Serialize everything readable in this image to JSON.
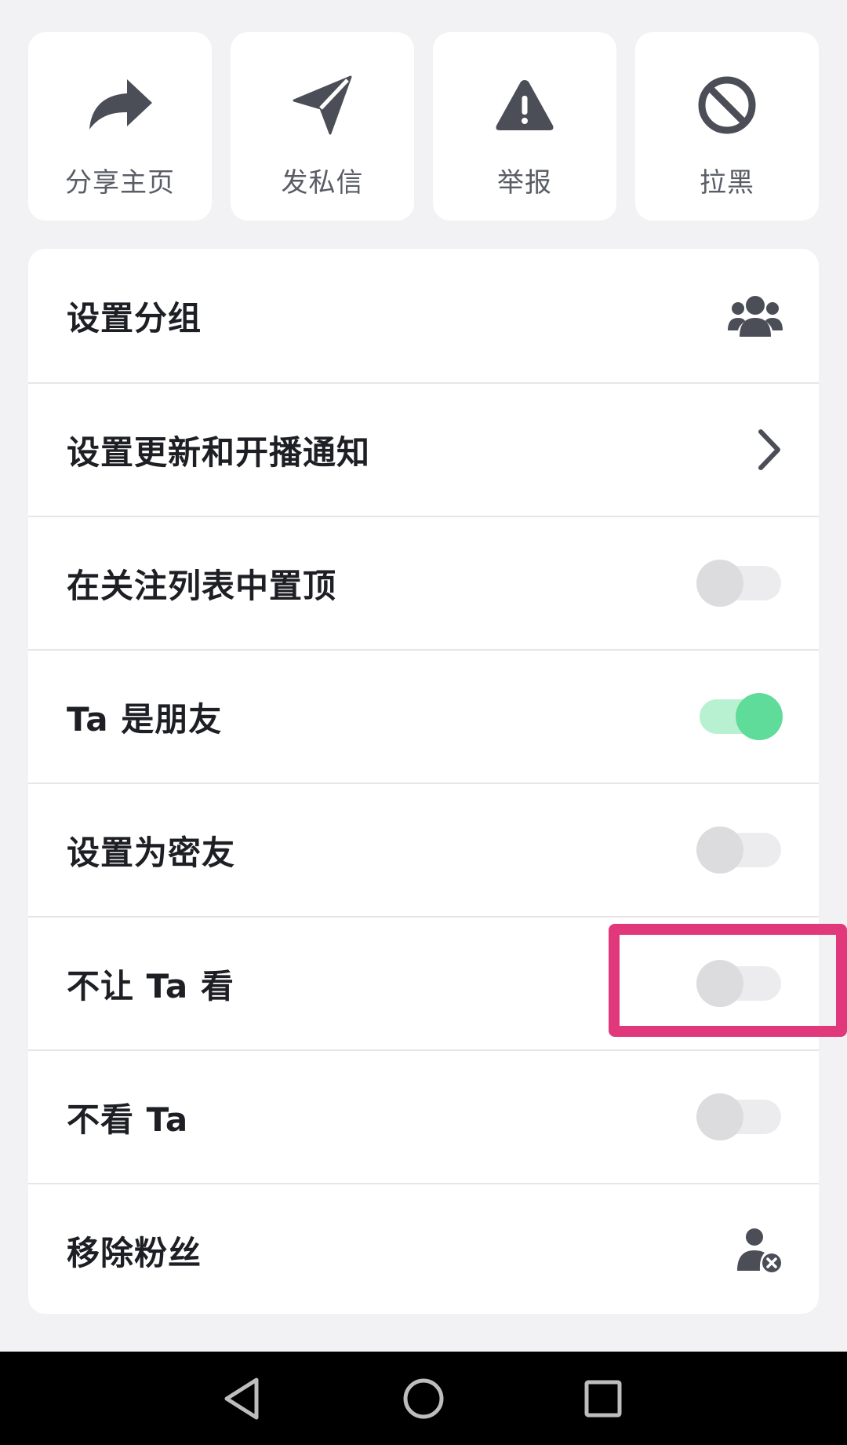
{
  "actions": [
    {
      "label": "分享主页",
      "icon": "share-arrow-icon"
    },
    {
      "label": "发私信",
      "icon": "paper-plane-icon"
    },
    {
      "label": "举报",
      "icon": "warning-triangle-icon"
    },
    {
      "label": "拉黑",
      "icon": "block-icon"
    }
  ],
  "settings": {
    "set_group": {
      "label": "设置分组",
      "icon": "group-users-icon"
    },
    "update_notify": {
      "label": "设置更新和开播通知",
      "icon": "chevron-right-icon"
    },
    "pin_top": {
      "label": "在关注列表中置顶",
      "toggle_on": false
    },
    "is_friend": {
      "label": "Ta 是朋友",
      "toggle_on": true
    },
    "close_friend": {
      "label": "设置为密友",
      "toggle_on": false
    },
    "hide_from": {
      "label": "不让 Ta 看",
      "toggle_on": false
    },
    "dont_see": {
      "label": "不看 Ta",
      "toggle_on": false
    },
    "remove_fan": {
      "label": "移除粉丝",
      "icon": "remove-user-icon"
    }
  },
  "colors": {
    "toggle_on_knob": "#5fdb9a",
    "toggle_on_track": "#b8f0d2",
    "highlight": "#e0387a",
    "icon": "#4b4e57"
  },
  "navbar": {
    "back": "back-triangle-icon",
    "home": "home-circle-icon",
    "recents": "recents-square-icon"
  }
}
